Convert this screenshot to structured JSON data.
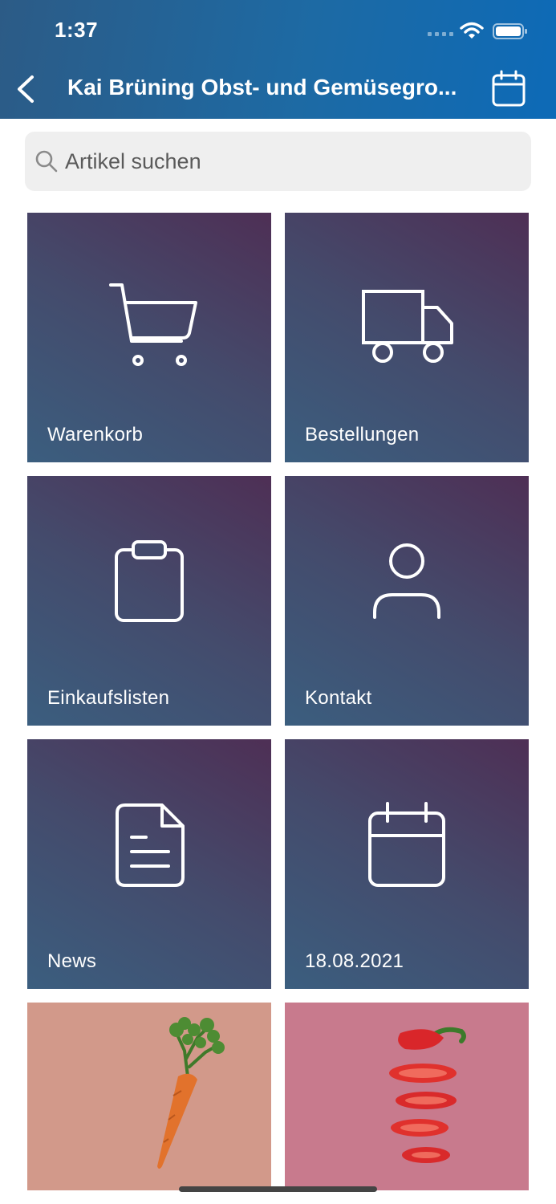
{
  "status_bar": {
    "time": "1:37"
  },
  "nav": {
    "title": "Kai Brüning Obst- und Gemüsegro..."
  },
  "search": {
    "placeholder": "Artikel suchen"
  },
  "tiles": [
    {
      "label": "Warenkorb",
      "icon": "cart-icon"
    },
    {
      "label": "Bestellungen",
      "icon": "truck-icon"
    },
    {
      "label": "Einkaufslisten",
      "icon": "clipboard-icon"
    },
    {
      "label": "Kontakt",
      "icon": "person-icon"
    },
    {
      "label": "News",
      "icon": "document-icon"
    },
    {
      "label": "18.08.2021",
      "icon": "calendar-icon"
    }
  ],
  "promo_images": [
    {
      "subject": "carrot",
      "background": "#d2998a"
    },
    {
      "subject": "red-pepper-slices",
      "background": "#c87a8d"
    }
  ],
  "colors": {
    "header_start": "#2c5b86",
    "header_end": "#0d6ab7",
    "tile_start": "#3b5e7f",
    "tile_end": "#4e2f55"
  }
}
